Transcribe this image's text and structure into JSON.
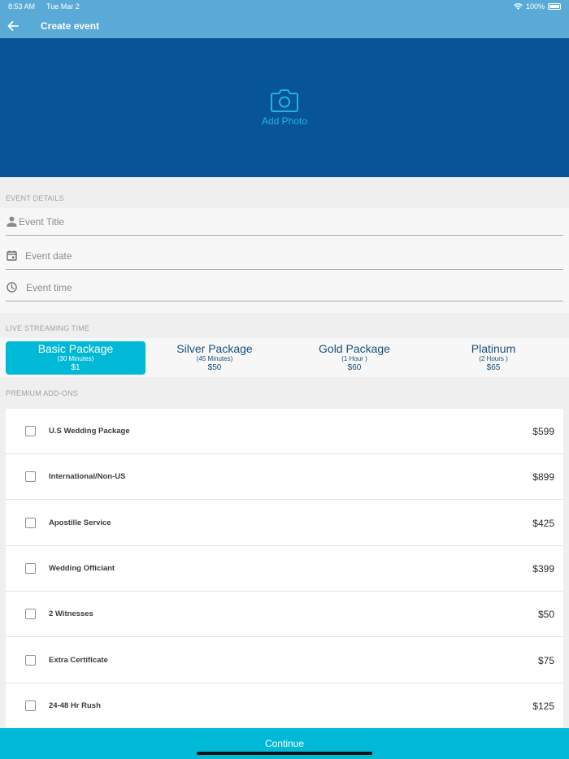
{
  "status_bar": {
    "time": "8:53 AM",
    "date": "Tue Mar 2",
    "battery": "100%"
  },
  "nav": {
    "title": "Create event",
    "back_icon": "arrow-left-icon"
  },
  "photo": {
    "label": "Add Photo",
    "icon": "camera-icon"
  },
  "event_details": {
    "header": "EVENT DETAILS",
    "title_placeholder": "Event Title",
    "date_placeholder": "Event date",
    "time_placeholder": "Event time"
  },
  "streaming": {
    "header": "LIVE STREAMING TIME",
    "packages": [
      {
        "name": "Basic Package",
        "duration": "(30 Minutes)",
        "price": "$1",
        "selected": true
      },
      {
        "name": "Silver Package",
        "duration": "(45 Minutes)",
        "price": "$50",
        "selected": false
      },
      {
        "name": "Gold Package",
        "duration": "(1 Hour )",
        "price": "$60",
        "selected": false
      },
      {
        "name": "Platinum",
        "duration": "(2 Hours )",
        "price": "$65",
        "selected": false
      }
    ]
  },
  "addons": {
    "header": "PREMIUM ADD-ONS",
    "items": [
      {
        "name": "U.S Wedding Package",
        "price": "$599",
        "checked": false
      },
      {
        "name": "International/Non-US",
        "price": "$899",
        "checked": false
      },
      {
        "name": "Apostille Service",
        "price": "$425",
        "checked": false
      },
      {
        "name": "Wedding Officiant",
        "price": "$399",
        "checked": false
      },
      {
        "name": "2 Witnesses",
        "price": "$50",
        "checked": false
      },
      {
        "name": "Extra Certificate",
        "price": "$75",
        "checked": false
      },
      {
        "name": "24-48 Hr Rush",
        "price": "$125",
        "checked": false
      }
    ]
  },
  "continue_label": "Continue",
  "colors": {
    "header": "#5aaad8",
    "photo_bg": "#075597",
    "accent": "#00b9d7",
    "package_text": "#1a4e7a"
  }
}
